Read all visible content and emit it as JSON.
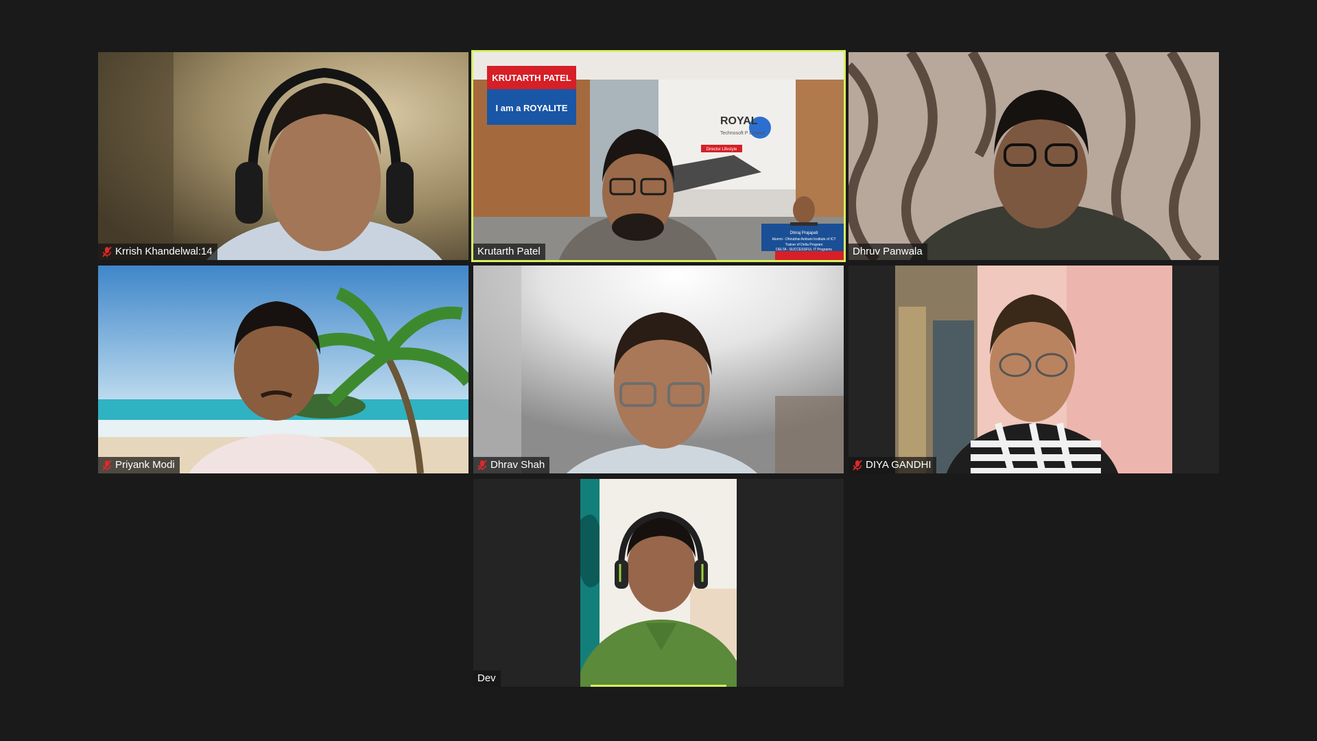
{
  "window": {
    "background": "#1a1a1a",
    "active_speaker_color": "#d8f061"
  },
  "participants": [
    {
      "name": "Krrish Khandelwal:14",
      "muted": true,
      "active": false,
      "background": "indoor-wall",
      "shirt": "#c9d3e0"
    },
    {
      "name": "Krutarth Patel",
      "muted": false,
      "active": true,
      "background": "royal-technosoft-virtual-office",
      "shirt": "#6f6a63"
    },
    {
      "name": "Dhruv Panwala",
      "muted": false,
      "active": false,
      "background": "patterned-curtain",
      "shirt": "#3a3b33"
    },
    {
      "name": "Priyank Modi",
      "muted": true,
      "active": false,
      "background": "beach-palm-tree",
      "shirt": "#f2e3e3"
    },
    {
      "name": "Dhrav Shah",
      "muted": true,
      "active": false,
      "background": "bright-room",
      "shirt": "#cfd7de"
    },
    {
      "name": "DIYA GANDHI",
      "muted": true,
      "active": false,
      "background": "curtain-pink-wall",
      "shirt": "#e8e8e8"
    },
    {
      "name": "Dev",
      "muted": false,
      "active": false,
      "background": "teal-door-room",
      "shirt": "#5a8a3a"
    }
  ],
  "virtual_background": {
    "badge_line1": "KRUTARTH PATEL",
    "badge_line2": "I am a ROYALITE",
    "company_logo": "ROYAL",
    "company_sub": "Technosoft P Limited",
    "company_tag": "Director Lifestyle",
    "card_name": "Dhiraj Prajapati",
    "card_line1": "Alumni - Dhirubhai Ambani Institute of ICT",
    "card_line2": "Trainer of Delta Program",
    "card_line3": "DELTA - SUCCESSFUL IT Programs"
  }
}
